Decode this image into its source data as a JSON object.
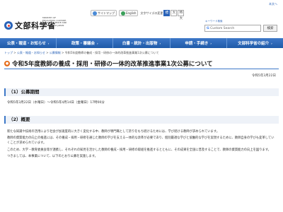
{
  "header": {
    "logo_text": "文部科学省",
    "logo_en": "MINISTRY OF EDUCATION, CULTURE, SPORTS, SCIENCE AND TECHNOLOGY-JAPAN",
    "skip_link": "本文へ",
    "sitemap": "サイトマップ",
    "english": "English",
    "font_size_label": "文字サイズの変更",
    "font_sizes": [
      "標準",
      "大",
      "特大"
    ],
    "search_label": "キーワード検索",
    "search_placeholder": "Custom Search",
    "search_button": "検索"
  },
  "nav": {
    "items": [
      "公表・報道・お知らせ",
      "政策・審議会",
      "白書・統計・出版物",
      "申請・手続き",
      "文部科学省の紹介"
    ]
  },
  "breadcrumb": {
    "items": [
      "トップ",
      "公表・報道・お知らせ",
      "公募情報",
      "令和5年度教師の養成・採用・研修の一体的改革推進事業1次公募について"
    ]
  },
  "page": {
    "title": "令和5年度教師の養成・採用・研修の一体的改革推進事業1次公募について",
    "date": "令和5年3月22日",
    "section1_heading": "（1）公募期間",
    "schedule": "令和5年3月22日（水曜日）～令和5年4月14日（金曜日）17時00分",
    "section2_heading": "（2）概要",
    "overview": [
      "新たな知識や技術の活用により社会が加速度的に大きく変化する中、教師が専門職として誇りをもち続けるためには、学び続ける教師が求められています。",
      "教師の資質能力の向上の推進には、その養成・採用・研修を通じた教師の学びを支える一体的な改革が必要であり、個別最適な学びと協働的な学びを実現するために、教師自身の学びも変革していくことが求められています。",
      "このため、大学・教育委員会等が連携し、それぞれの知見を活かした教師の養成・採用・研修の取組を推進するとともに、その成果を全国に普及することで、教師の資質能力の向上を図ります。",
      "つきましては、本事業について、以下のとおり公募を実施します。"
    ]
  }
}
